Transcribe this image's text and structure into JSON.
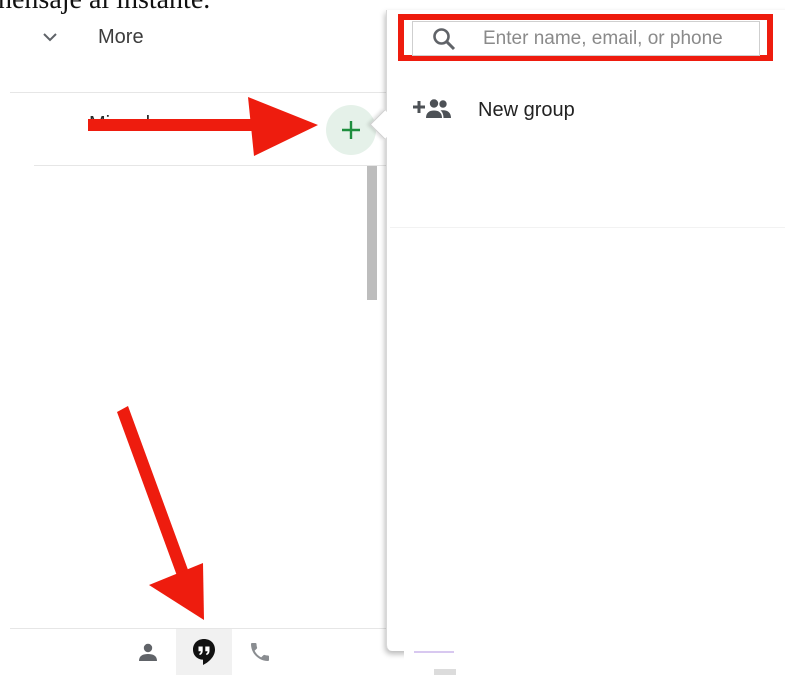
{
  "caption": "nensaje al instante.",
  "sidebar": {
    "more_label": "More",
    "contact_name": "Miranda",
    "tabs": [
      {
        "name": "contacts",
        "icon": "person-icon",
        "active": false
      },
      {
        "name": "conversations",
        "icon": "hangouts-quote-icon",
        "active": true
      },
      {
        "name": "phone-calls",
        "icon": "phone-icon",
        "active": false
      }
    ]
  },
  "panel": {
    "search_placeholder": "Enter name, email, or phone",
    "search_value": "",
    "new_group_label": "New group"
  },
  "colors": {
    "annotation_red": "#ee1c0e",
    "add_button_bg": "#e5f1e9",
    "add_button_plus": "#1e8e3e",
    "icon_grey": "#606368"
  }
}
